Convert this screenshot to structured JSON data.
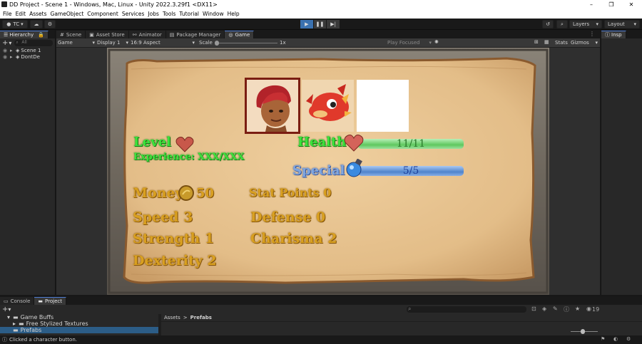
{
  "window": {
    "title": "DD Project - Scene 1 - Windows, Mac, Linux - Unity 2022.3.29f1 <DX11>",
    "min": "–",
    "max": "❐",
    "close": "✕"
  },
  "menu": [
    "File",
    "Edit",
    "Assets",
    "GameObject",
    "Component",
    "Services",
    "Jobs",
    "Tools",
    "Tutorial",
    "Window",
    "Help"
  ],
  "toolbar": {
    "account": "TC",
    "layers": "Layers",
    "layout": "Layout"
  },
  "hierarchy": {
    "tab": "Hierarchy",
    "search_placeholder": "All",
    "items": [
      "Scene 1",
      "DontDe"
    ]
  },
  "center_tabs": [
    "Scene",
    "Asset Store",
    "Animator",
    "Package Manager",
    "Game"
  ],
  "game_header": {
    "mode": "Game",
    "display": "Display 1",
    "aspect": "16:9 Aspect",
    "scale_label": "Scale",
    "scale_value": "1x",
    "play_focused": "Play Focused",
    "stats": "Stats",
    "gizmos": "Gizmos"
  },
  "inspector": {
    "tab": "Insp"
  },
  "game": {
    "level_label": "Level",
    "experience": "Experience: XXX/XXX",
    "health_label": "Health",
    "health_value": "11/11",
    "health_fraction": 1.0,
    "special_label": "Special",
    "special_value": "5/5",
    "special_fraction": 1.0,
    "money_label": "Money",
    "money_value": "50",
    "stat_points": "Stat Points 0",
    "speed": "Speed 3",
    "defense": "Defense 0",
    "strength": "Strength 1",
    "charisma": "Charisma 2",
    "dexterity": "Dexterity 2"
  },
  "bottom": {
    "tabs": [
      "Console",
      "Project"
    ],
    "tree": [
      "Game Buffs",
      "Free Stylized Textures",
      "Prefabs"
    ],
    "breadcrumb_root": "Assets",
    "breadcrumb_sep": ">",
    "breadcrumb_leaf": "Prefabs",
    "count": "19"
  },
  "status": {
    "message": "Clicked a character button."
  }
}
